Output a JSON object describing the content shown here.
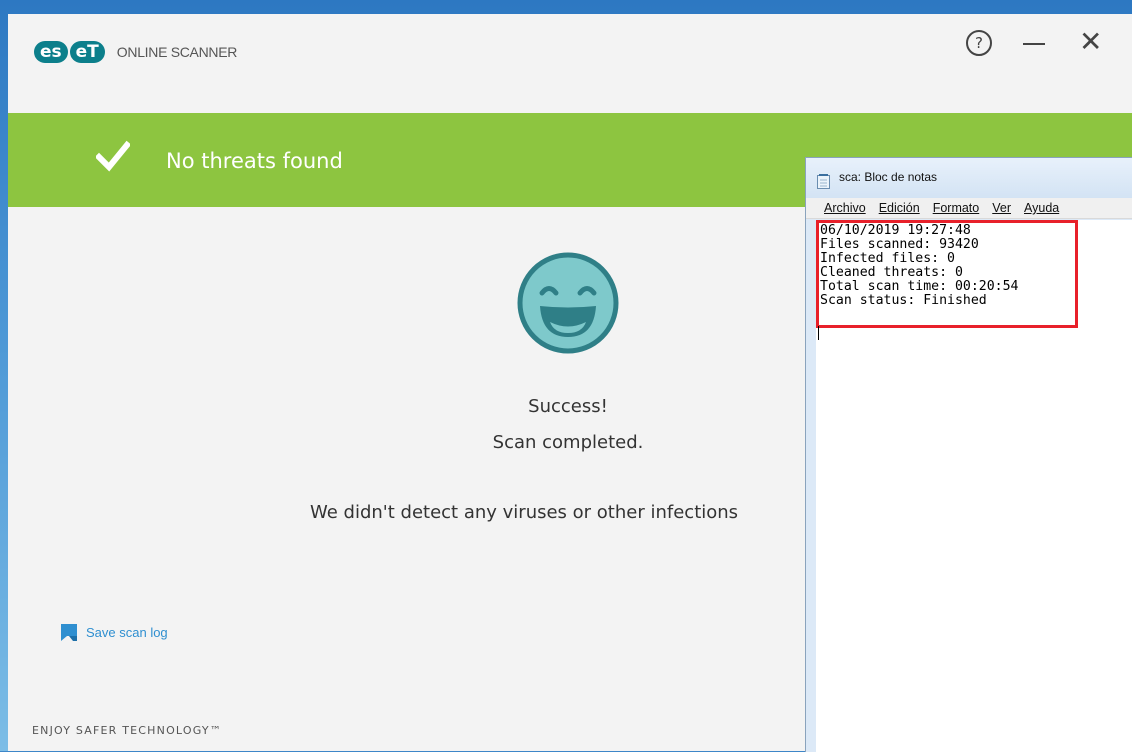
{
  "eset": {
    "logo_part1": "es",
    "logo_part2": "eT",
    "product_name": "ONLINE SCANNER",
    "help_label": "?",
    "close_label": "✕",
    "banner_text": "No threats found",
    "success_title": "Success!",
    "success_subtitle": "Scan completed.",
    "description": "We didn't detect any viruses or other infections",
    "save_log_label": "Save scan log",
    "footer": "ENJOY SAFER TECHNOLOGY™",
    "accent_color": "#8dc540",
    "brand_color": "#0c7f8b"
  },
  "notepad": {
    "title": "sca: Bloc de notas",
    "menu": [
      "Archivo",
      "Edición",
      "Formato",
      "Ver",
      "Ayuda"
    ],
    "lines": [
      "06/10/2019 19:27:48",
      "Files scanned: 93420",
      "Infected files: 0",
      "Cleaned threats: 0",
      "Total scan time: 00:20:54",
      "Scan status: Finished"
    ],
    "highlight_color": "#e8202a"
  }
}
